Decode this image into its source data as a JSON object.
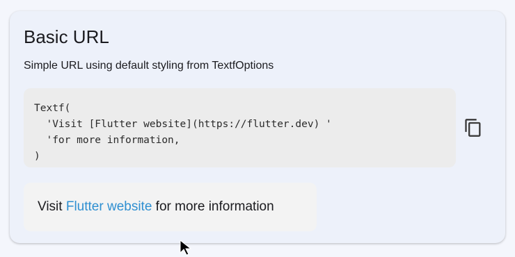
{
  "card": {
    "title": "Basic URL",
    "subtitle": "Simple URL using default styling from TextfOptions"
  },
  "code": {
    "lines": [
      "Textf(",
      "  'Visit [Flutter website](https://flutter.dev) '",
      "  'for more information,",
      ")"
    ],
    "copy_icon": "copy-icon"
  },
  "preview": {
    "prefix": "Visit ",
    "link_text": "Flutter website",
    "suffix": " for more information",
    "link_color": "#2e8fd1"
  },
  "colors": {
    "page_background": "#f4f6fc",
    "card_background": "#edf1fa",
    "code_background": "#ececec"
  }
}
